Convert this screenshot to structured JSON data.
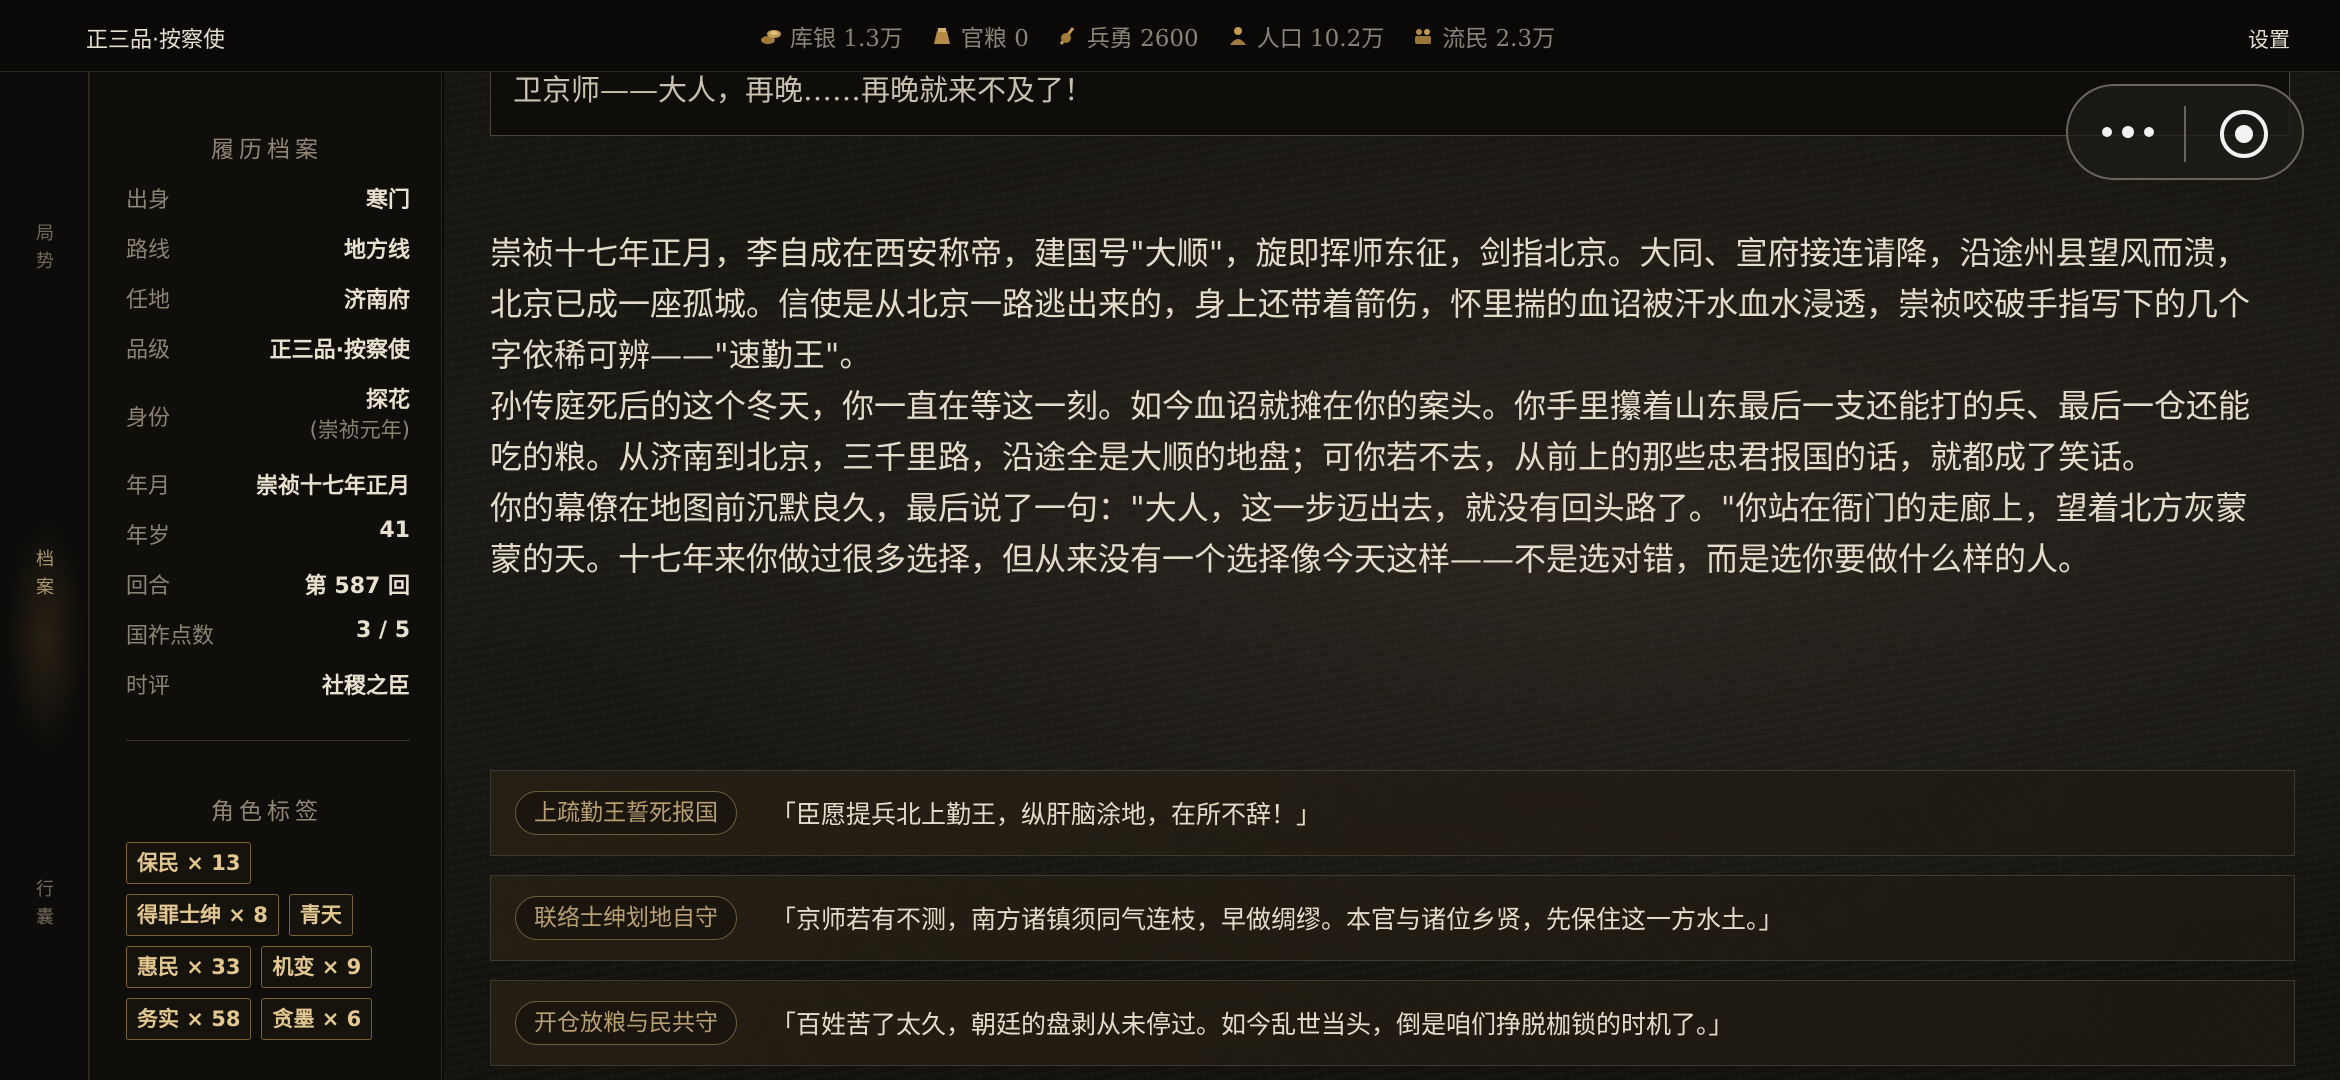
{
  "header": {
    "rank": "正三品·按察使",
    "settings_label": "设置",
    "resources": [
      {
        "icon": "silver-coins-icon",
        "label": "库银 1.3万"
      },
      {
        "icon": "grain-sack-icon",
        "label": "官粮 0"
      },
      {
        "icon": "soldier-icon",
        "label": "兵勇 2600"
      },
      {
        "icon": "population-icon",
        "label": "人口 10.2万"
      },
      {
        "icon": "refugee-icon",
        "label": "流民 2.3万"
      }
    ]
  },
  "nav": {
    "items": [
      {
        "label": "局势"
      },
      {
        "label": "档案"
      },
      {
        "label": "行囊"
      }
    ]
  },
  "profile": {
    "title": "履历档案",
    "rows": [
      {
        "key": "出身",
        "value": "寒门"
      },
      {
        "key": "路线",
        "value": "地方线"
      },
      {
        "key": "任地",
        "value": "济南府"
      },
      {
        "key": "品级",
        "value": "正三品·按察使"
      },
      {
        "key": "身份",
        "value": "探花",
        "sub": "(崇祯元年)"
      },
      {
        "key": "年月",
        "value": "崇祯十七年正月"
      },
      {
        "key": "年岁",
        "value": "41"
      },
      {
        "key": "回合",
        "value": "第 587 回"
      },
      {
        "key": "国祚点数",
        "value": "3 / 5"
      },
      {
        "key": "时评",
        "value": "社稷之臣"
      }
    ],
    "tags_title": "角色标签",
    "tags": [
      "保民 × 13",
      "得罪士绅 × 8",
      "青天",
      "惠民 × 33",
      "机变 × 9",
      "务实 × 58",
      "贪墨 × 6"
    ]
  },
  "main": {
    "prev_message": "卫京师——大人，再晚……再晚就来不及了！",
    "story": [
      "崇祯十七年正月，李自成在西安称帝，建国号\"大顺\"，旋即挥师东征，剑指北京。大同、宣府接连请降，沿途州县望风而溃，北京已成一座孤城。信使是从北京一路逃出来的，身上还带着箭伤，怀里揣的血诏被汗水血水浸透，崇祯咬破手指写下的几个字依稀可辨——\"速勤王\"。",
      "孙传庭死后的这个冬天，你一直在等这一刻。如今血诏就摊在你的案头。你手里攥着山东最后一支还能打的兵、最后一仓还能吃的粮。从济南到北京，三千里路，沿途全是大顺的地盘；可你若不去，从前上的那些忠君报国的话，就都成了笑话。",
      "你的幕僚在地图前沉默良久，最后说了一句：\"大人，这一步迈出去，就没有回头路了。\"你站在衙门的走廊上，望着北方灰蒙蒙的天。十七年来你做过很多选择，但从来没有一个选择像今天这样——不是选对错，而是选你要做什么样的人。"
    ],
    "choices": [
      {
        "tag": "上疏勤王誓死报国",
        "text": "「臣愿提兵北上勤王，纵肝脑涂地，在所不辞！」"
      },
      {
        "tag": "联络士绅划地自守",
        "text": "「京师若有不测，南方诸镇须同气连枝，早做绸缪。本官与诸位乡贤，先保住这一方水土。」"
      },
      {
        "tag": "开仓放粮与民共守",
        "text": "「百姓苦了太久，朝廷的盘剥从未停过。如今乱世当头，倒是咱们挣脱枷锁的时机了。」"
      }
    ]
  },
  "colors": {
    "accent_gold": "#e2c890",
    "tag_border": "#7a6333",
    "text_main": "#e4dccb",
    "text_muted": "#8a8373"
  }
}
